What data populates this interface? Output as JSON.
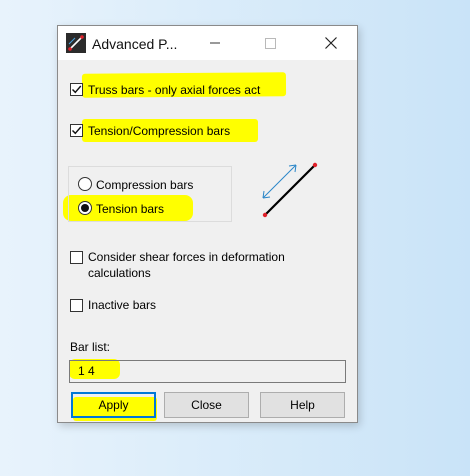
{
  "window": {
    "title": "Advanced P..."
  },
  "options": {
    "truss_bars_label": "Truss bars - only axial forces act",
    "truss_bars_checked": true,
    "tension_compression_label": "Tension/Compression bars",
    "tension_compression_checked": true,
    "compression_bars_label": "Compression bars",
    "tension_bars_label": "Tension bars",
    "selected_radio": "tension",
    "shear_forces_label": "Consider shear forces in deformation calculations",
    "shear_forces_line1": "Consider shear forces in deformation",
    "shear_forces_line2": "calculations",
    "shear_forces_checked": false,
    "inactive_bars_label": "Inactive bars",
    "inactive_bars_checked": false
  },
  "bar_list": {
    "label": "Bar list:",
    "value": "1 4"
  },
  "buttons": {
    "apply": "Apply",
    "close": "Close",
    "help": "Help"
  },
  "colors": {
    "highlight": "#ffff00",
    "focus_blue": "#0078d7",
    "bar_end": "#e0202a",
    "arrow": "#2a86c8"
  }
}
